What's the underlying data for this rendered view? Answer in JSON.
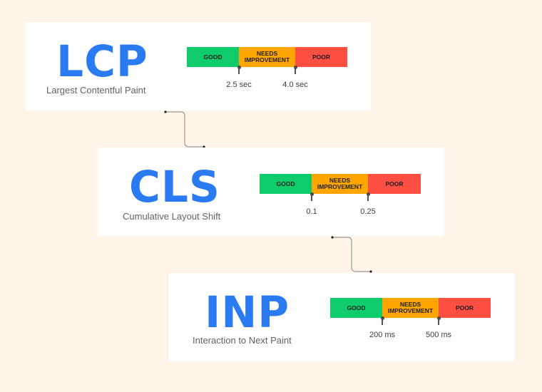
{
  "colors": {
    "background": "#fef5e8",
    "card": "#ffffff",
    "accent_blue": "#2a7bf1",
    "good": "#0ecb6b",
    "needs_improvement": "#ffa500",
    "poor": "#ff4e42",
    "connector": "#9a9a9a"
  },
  "metrics": [
    {
      "abbr": "LCP",
      "name": "Largest Contentful Paint",
      "segments": {
        "good": "GOOD",
        "needs_improvement": "NEEDS\nIMPROVEMENT",
        "poor": "POOR"
      },
      "thresholds": [
        "2.5 sec",
        "4.0 sec"
      ]
    },
    {
      "abbr": "CLS",
      "name": "Cumulative Layout Shift",
      "segments": {
        "good": "GOOD",
        "needs_improvement": "NEEDS\nIMPROVEMENT",
        "poor": "POOR"
      },
      "thresholds": [
        "0.1",
        "0.25"
      ]
    },
    {
      "abbr": "INP",
      "name": "Interaction to Next Paint",
      "segments": {
        "good": "GOOD",
        "needs_improvement": "NEEDS\nIMPROVEMENT",
        "poor": "POOR"
      },
      "thresholds": [
        "200 ms",
        "500 ms"
      ]
    }
  ]
}
